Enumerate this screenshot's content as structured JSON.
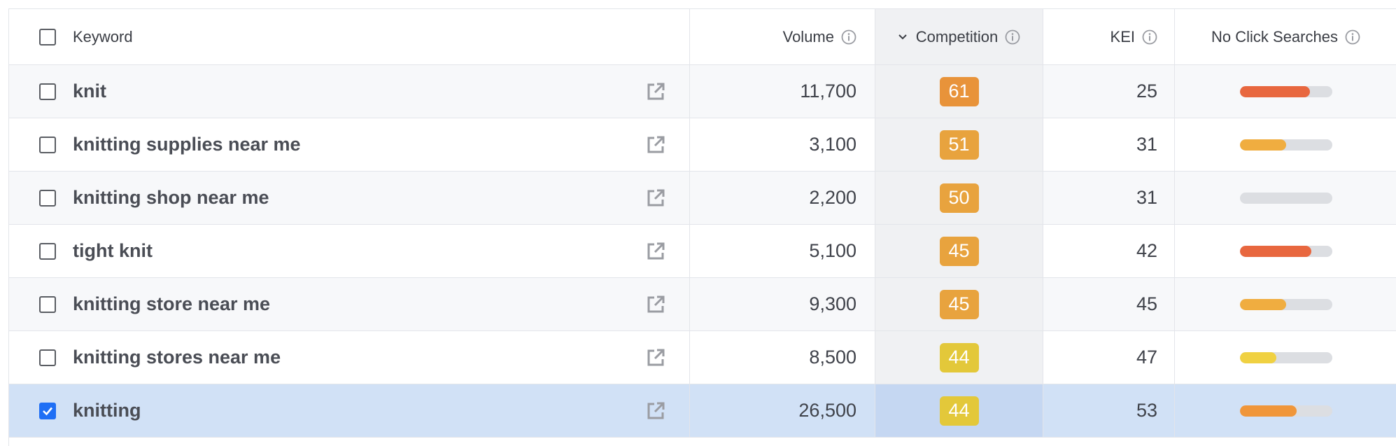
{
  "header": {
    "keyword": "Keyword",
    "volume": "Volume",
    "competition": "Competition",
    "kei": "KEI",
    "no_click": "No Click Searches"
  },
  "rows": [
    {
      "keyword": "knit",
      "volume": "11,700",
      "competition": "61",
      "competition_color": "#e8933a",
      "kei": "25",
      "no_click_fraction": 0.76,
      "no_click_color": "#e8673f",
      "selected": false
    },
    {
      "keyword": "knitting supplies near me",
      "volume": "3,100",
      "competition": "51",
      "competition_color": "#e8a33e",
      "kei": "31",
      "no_click_fraction": 0.5,
      "no_click_color": "#f0ad40",
      "selected": false
    },
    {
      "keyword": "knitting shop near me",
      "volume": "2,200",
      "competition": "50",
      "competition_color": "#e8a33e",
      "kei": "31",
      "no_click_fraction": 0.0,
      "no_click_color": "#f0ad40",
      "selected": false
    },
    {
      "keyword": "tight knit",
      "volume": "5,100",
      "competition": "45",
      "competition_color": "#e8a33e",
      "kei": "42",
      "no_click_fraction": 0.78,
      "no_click_color": "#e8673f",
      "selected": false
    },
    {
      "keyword": "knitting store near me",
      "volume": "9,300",
      "competition": "45",
      "competition_color": "#e8a33e",
      "kei": "45",
      "no_click_fraction": 0.5,
      "no_click_color": "#f0ad40",
      "selected": false
    },
    {
      "keyword": "knitting stores near me",
      "volume": "8,500",
      "competition": "44",
      "competition_color": "#e3c83a",
      "kei": "47",
      "no_click_fraction": 0.4,
      "no_click_color": "#f0d142",
      "selected": false
    },
    {
      "keyword": "knitting",
      "volume": "26,500",
      "competition": "44",
      "competition_color": "#e3c83a",
      "kei": "53",
      "no_click_fraction": 0.62,
      "no_click_color": "#f0963a",
      "selected": true
    }
  ]
}
